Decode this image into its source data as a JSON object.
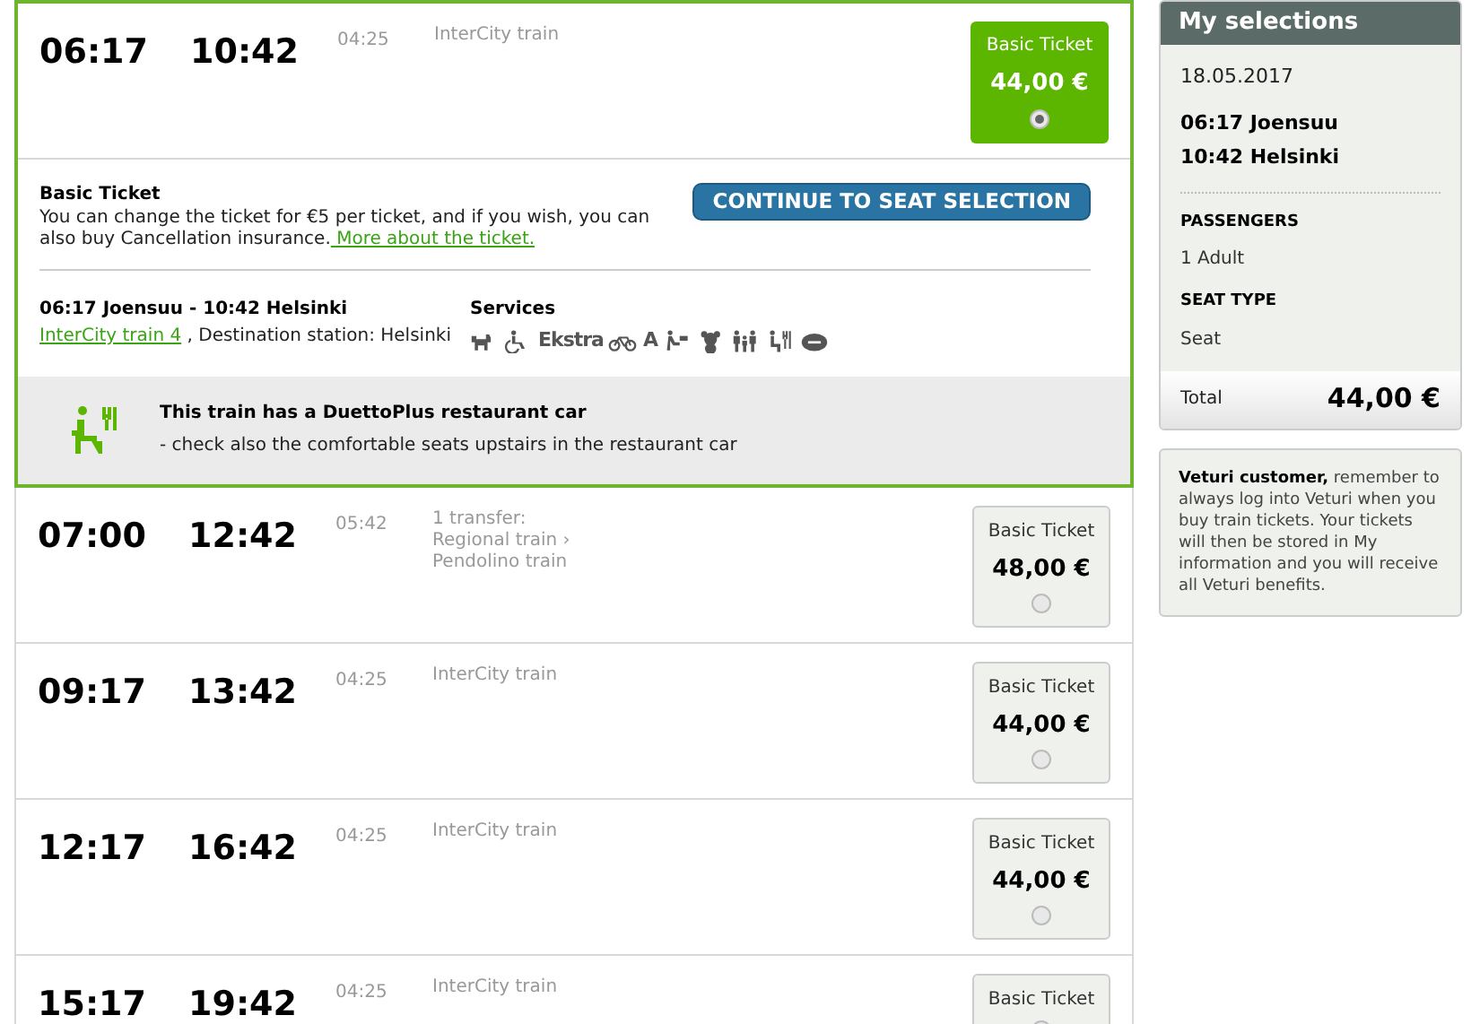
{
  "journeys": [
    {
      "depart": "06:17",
      "arrive": "10:42",
      "duration": "04:25",
      "info": [
        "InterCity train"
      ],
      "ticket": {
        "label": "Basic Ticket",
        "price": "44,00 €",
        "selected": true
      },
      "expanded": true
    },
    {
      "depart": "07:00",
      "arrive": "12:42",
      "duration": "05:42",
      "info": [
        "1 transfer:",
        "Regional train ›",
        "Pendolino train"
      ],
      "ticket": {
        "label": "Basic Ticket",
        "price": "48,00 €",
        "selected": false
      },
      "expanded": false
    },
    {
      "depart": "09:17",
      "arrive": "13:42",
      "duration": "04:25",
      "info": [
        "InterCity train"
      ],
      "ticket": {
        "label": "Basic Ticket",
        "price": "44,00 €",
        "selected": false
      },
      "expanded": false
    },
    {
      "depart": "12:17",
      "arrive": "16:42",
      "duration": "04:25",
      "info": [
        "InterCity train"
      ],
      "ticket": {
        "label": "Basic Ticket",
        "price": "44,00 €",
        "selected": false
      },
      "expanded": false
    },
    {
      "depart": "15:17",
      "arrive": "19:42",
      "duration": "04:25",
      "info": [
        "InterCity train"
      ],
      "ticket": {
        "label": "Basic Ticket",
        "selected": false
      },
      "expanded": false
    }
  ],
  "details": {
    "ticket_title": "Basic Ticket",
    "ticket_text": "You can change the ticket for €5 per ticket, and if you wish, you can also buy Cancellation insurance.",
    "ticket_link": " More about the ticket.",
    "continue_button": "CONTINUE TO SEAT SELECTION",
    "route": "06:17 Joensuu - 10:42 Helsinki",
    "train_link": "InterCity train 4",
    "destination": " , Destination station: Helsinki",
    "services_title": "Services",
    "service_badges": [
      "Ekstra",
      "A"
    ],
    "notice_title": "This train has a DuettoPlus restaurant car",
    "notice_text": "- check also the comfortable seats upstairs in the restaurant car"
  },
  "selections": {
    "title": "My selections",
    "date": "18.05.2017",
    "from": "06:17 Joensuu",
    "to": "10:42 Helsinki",
    "passengers_label": "PASSENGERS",
    "passengers": "1 Adult",
    "seat_label": "SEAT TYPE",
    "seat": "Seat",
    "total_label": "Total",
    "total": "44,00 €"
  },
  "info_box": {
    "bold": "Veturi customer,",
    "text": " remember to always log into Veturi when you buy train tickets. Your tickets will then be stored in My information and you will receive all Veturi benefits."
  }
}
